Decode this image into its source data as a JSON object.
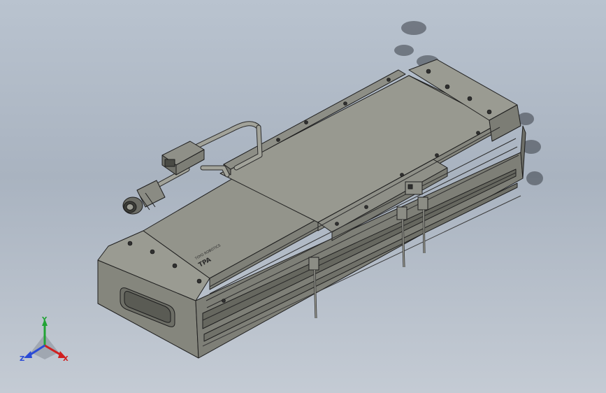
{
  "viewport": {
    "background": "#b2bcc8",
    "model_color": "#8b8c83",
    "edge_color": "#1f1f1f"
  },
  "part_marking": {
    "logo": "TPA",
    "small_text": "TOYO ROBOTICS"
  },
  "triad": {
    "x_label": "X",
    "y_label": "Y",
    "z_label": "Z",
    "x_color": "#d11f1f",
    "y_color": "#22a335",
    "z_color": "#2b4bd6"
  }
}
